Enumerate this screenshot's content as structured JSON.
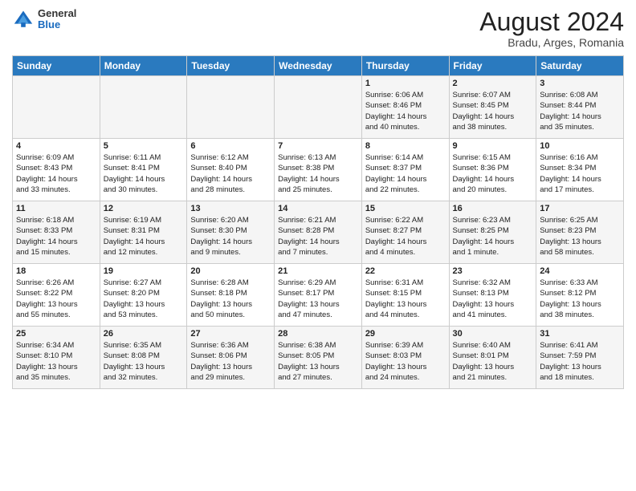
{
  "header": {
    "logo": {
      "general": "General",
      "blue": "Blue"
    },
    "title": "August 2024",
    "subtitle": "Bradu, Arges, Romania"
  },
  "weekdays": [
    "Sunday",
    "Monday",
    "Tuesday",
    "Wednesday",
    "Thursday",
    "Friday",
    "Saturday"
  ],
  "weeks": [
    [
      {
        "day": "",
        "info": ""
      },
      {
        "day": "",
        "info": ""
      },
      {
        "day": "",
        "info": ""
      },
      {
        "day": "",
        "info": ""
      },
      {
        "day": "1",
        "info": "Sunrise: 6:06 AM\nSunset: 8:46 PM\nDaylight: 14 hours\nand 40 minutes."
      },
      {
        "day": "2",
        "info": "Sunrise: 6:07 AM\nSunset: 8:45 PM\nDaylight: 14 hours\nand 38 minutes."
      },
      {
        "day": "3",
        "info": "Sunrise: 6:08 AM\nSunset: 8:44 PM\nDaylight: 14 hours\nand 35 minutes."
      }
    ],
    [
      {
        "day": "4",
        "info": "Sunrise: 6:09 AM\nSunset: 8:43 PM\nDaylight: 14 hours\nand 33 minutes."
      },
      {
        "day": "5",
        "info": "Sunrise: 6:11 AM\nSunset: 8:41 PM\nDaylight: 14 hours\nand 30 minutes."
      },
      {
        "day": "6",
        "info": "Sunrise: 6:12 AM\nSunset: 8:40 PM\nDaylight: 14 hours\nand 28 minutes."
      },
      {
        "day": "7",
        "info": "Sunrise: 6:13 AM\nSunset: 8:38 PM\nDaylight: 14 hours\nand 25 minutes."
      },
      {
        "day": "8",
        "info": "Sunrise: 6:14 AM\nSunset: 8:37 PM\nDaylight: 14 hours\nand 22 minutes."
      },
      {
        "day": "9",
        "info": "Sunrise: 6:15 AM\nSunset: 8:36 PM\nDaylight: 14 hours\nand 20 minutes."
      },
      {
        "day": "10",
        "info": "Sunrise: 6:16 AM\nSunset: 8:34 PM\nDaylight: 14 hours\nand 17 minutes."
      }
    ],
    [
      {
        "day": "11",
        "info": "Sunrise: 6:18 AM\nSunset: 8:33 PM\nDaylight: 14 hours\nand 15 minutes."
      },
      {
        "day": "12",
        "info": "Sunrise: 6:19 AM\nSunset: 8:31 PM\nDaylight: 14 hours\nand 12 minutes."
      },
      {
        "day": "13",
        "info": "Sunrise: 6:20 AM\nSunset: 8:30 PM\nDaylight: 14 hours\nand 9 minutes."
      },
      {
        "day": "14",
        "info": "Sunrise: 6:21 AM\nSunset: 8:28 PM\nDaylight: 14 hours\nand 7 minutes."
      },
      {
        "day": "15",
        "info": "Sunrise: 6:22 AM\nSunset: 8:27 PM\nDaylight: 14 hours\nand 4 minutes."
      },
      {
        "day": "16",
        "info": "Sunrise: 6:23 AM\nSunset: 8:25 PM\nDaylight: 14 hours\nand 1 minute."
      },
      {
        "day": "17",
        "info": "Sunrise: 6:25 AM\nSunset: 8:23 PM\nDaylight: 13 hours\nand 58 minutes."
      }
    ],
    [
      {
        "day": "18",
        "info": "Sunrise: 6:26 AM\nSunset: 8:22 PM\nDaylight: 13 hours\nand 55 minutes."
      },
      {
        "day": "19",
        "info": "Sunrise: 6:27 AM\nSunset: 8:20 PM\nDaylight: 13 hours\nand 53 minutes."
      },
      {
        "day": "20",
        "info": "Sunrise: 6:28 AM\nSunset: 8:18 PM\nDaylight: 13 hours\nand 50 minutes."
      },
      {
        "day": "21",
        "info": "Sunrise: 6:29 AM\nSunset: 8:17 PM\nDaylight: 13 hours\nand 47 minutes."
      },
      {
        "day": "22",
        "info": "Sunrise: 6:31 AM\nSunset: 8:15 PM\nDaylight: 13 hours\nand 44 minutes."
      },
      {
        "day": "23",
        "info": "Sunrise: 6:32 AM\nSunset: 8:13 PM\nDaylight: 13 hours\nand 41 minutes."
      },
      {
        "day": "24",
        "info": "Sunrise: 6:33 AM\nSunset: 8:12 PM\nDaylight: 13 hours\nand 38 minutes."
      }
    ],
    [
      {
        "day": "25",
        "info": "Sunrise: 6:34 AM\nSunset: 8:10 PM\nDaylight: 13 hours\nand 35 minutes."
      },
      {
        "day": "26",
        "info": "Sunrise: 6:35 AM\nSunset: 8:08 PM\nDaylight: 13 hours\nand 32 minutes."
      },
      {
        "day": "27",
        "info": "Sunrise: 6:36 AM\nSunset: 8:06 PM\nDaylight: 13 hours\nand 29 minutes."
      },
      {
        "day": "28",
        "info": "Sunrise: 6:38 AM\nSunset: 8:05 PM\nDaylight: 13 hours\nand 27 minutes."
      },
      {
        "day": "29",
        "info": "Sunrise: 6:39 AM\nSunset: 8:03 PM\nDaylight: 13 hours\nand 24 minutes."
      },
      {
        "day": "30",
        "info": "Sunrise: 6:40 AM\nSunset: 8:01 PM\nDaylight: 13 hours\nand 21 minutes."
      },
      {
        "day": "31",
        "info": "Sunrise: 6:41 AM\nSunset: 7:59 PM\nDaylight: 13 hours\nand 18 minutes."
      }
    ]
  ]
}
